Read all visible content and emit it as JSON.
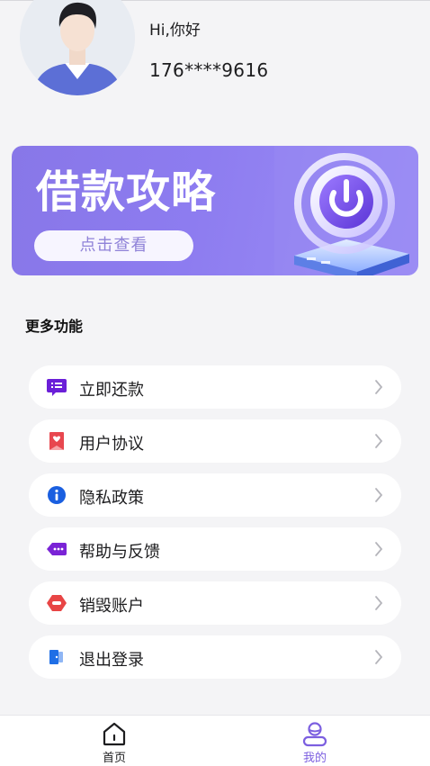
{
  "profile": {
    "greeting": "Hi,你好",
    "phone": "176****9616"
  },
  "banner": {
    "title": "借款攻略",
    "button_label": "点击查看"
  },
  "section": {
    "title": "更多功能"
  },
  "menu": [
    {
      "label": "立即还款",
      "icon": "repay-list-icon",
      "icon_color": "#6b1fd8"
    },
    {
      "label": "用户协议",
      "icon": "agreement-bookmark-icon",
      "icon_color": "#e8474f"
    },
    {
      "label": "隐私政策",
      "icon": "info-circle-icon",
      "icon_color": "#1a5fe0"
    },
    {
      "label": "帮助与反馈",
      "icon": "feedback-tag-icon",
      "icon_color": "#7a23d6"
    },
    {
      "label": "销毁账户",
      "icon": "destroy-account-icon",
      "icon_color": "#e84545"
    },
    {
      "label": "退出登录",
      "icon": "logout-door-icon",
      "icon_color": "#1f6fe6"
    }
  ],
  "bottom_nav": {
    "home": {
      "label": "首页",
      "icon": "home-icon",
      "active": false
    },
    "mine": {
      "label": "我的",
      "icon": "profile-icon",
      "active": true
    }
  },
  "colors": {
    "accent": "#7c5fe0",
    "banner_gradient_start": "#8877e8",
    "banner_gradient_end": "#9c8ef5",
    "page_background": "#f4f4f6"
  }
}
